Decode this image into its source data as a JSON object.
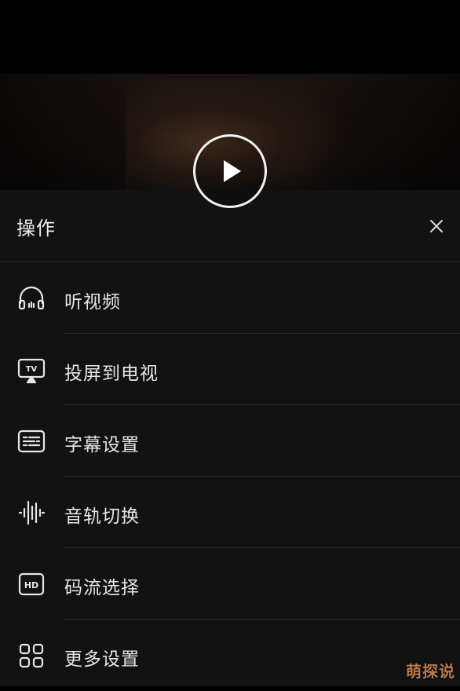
{
  "sheet": {
    "title": "操作",
    "items": [
      {
        "label": "听视频",
        "icon": "headphones-icon"
      },
      {
        "label": "投屏到电视",
        "icon": "tv-cast-icon"
      },
      {
        "label": "字幕设置",
        "icon": "subtitle-icon"
      },
      {
        "label": "音轨切换",
        "icon": "audio-waveform-icon"
      },
      {
        "label": "码流选择",
        "icon": "hd-icon"
      },
      {
        "label": "更多设置",
        "icon": "grid-icon"
      }
    ]
  },
  "watermark": "萌探说",
  "colors": {
    "sheet_bg": "#121212",
    "divider": "#2a2a2a",
    "text": "#e6e6e6"
  }
}
